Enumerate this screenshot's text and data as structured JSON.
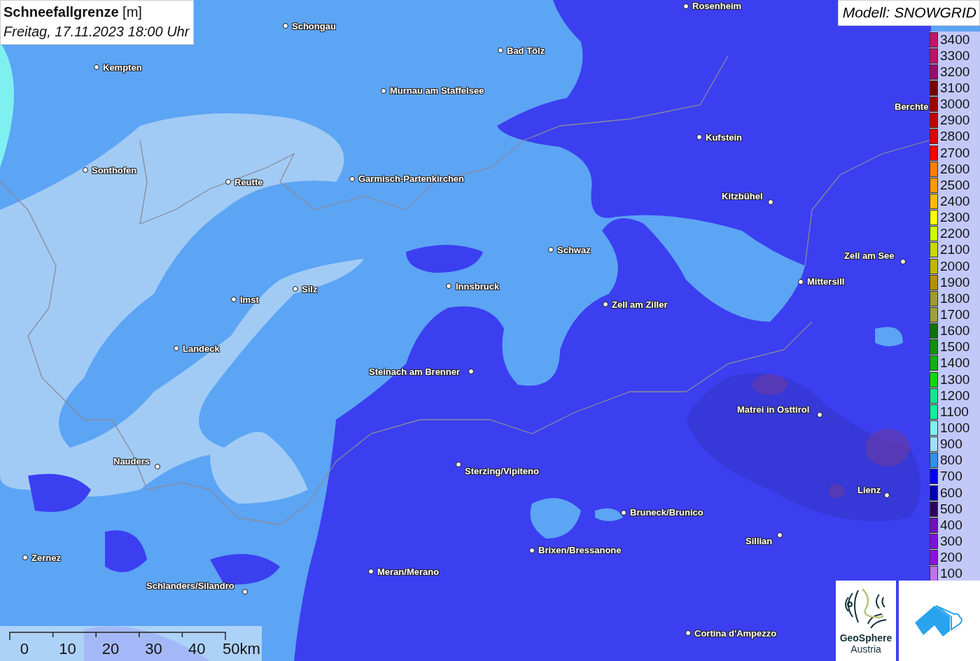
{
  "title": {
    "heading": "**Schneefallgrenze** [m]",
    "datetime": "Freitag, 17.11.2023 18:00 Uhr"
  },
  "model": "Modell: SNOWGRID",
  "cities": [
    {
      "name": "Rosenheim"
    },
    {
      "name": "Schongau"
    },
    {
      "name": "Kempten"
    },
    {
      "name": "Bad Tölz"
    },
    {
      "name": "Murnau am Staffelsee"
    },
    {
      "name": "Kufstein"
    },
    {
      "name": "Berchte"
    },
    {
      "name": "Sonthofen"
    },
    {
      "name": "Reutte"
    },
    {
      "name": "Garmisch-Partenkirchen"
    },
    {
      "name": "Kitzbühel"
    },
    {
      "name": "Schwaz"
    },
    {
      "name": "Zell am See"
    },
    {
      "name": "Silz"
    },
    {
      "name": "Innsbruck"
    },
    {
      "name": "Mittersill"
    },
    {
      "name": "Imst"
    },
    {
      "name": "Zell am Ziller"
    },
    {
      "name": "Landeck"
    },
    {
      "name": "Steinach am Brenner"
    },
    {
      "name": "Matrei in Osttirol"
    },
    {
      "name": "Nauders"
    },
    {
      "name": "Sterzing/Vipiteno"
    },
    {
      "name": "Lienz"
    },
    {
      "name": "Bruneck/Brunico"
    },
    {
      "name": "Sillian"
    },
    {
      "name": "Brixen/Bressanone"
    },
    {
      "name": "Zernez"
    },
    {
      "name": "Meran/Merano"
    },
    {
      "name": "Schlanders/Silandro"
    },
    {
      "name": "Cortina d'Ampezzo"
    }
  ],
  "legend": [
    {
      "label": "3400",
      "color": "#c8106e"
    },
    {
      "label": "3300",
      "color": "#c0106a"
    },
    {
      "label": "3200",
      "color": "#9a0a70"
    },
    {
      "label": "3100",
      "color": "#7a0000"
    },
    {
      "label": "3000",
      "color": "#a00000"
    },
    {
      "label": "2900",
      "color": "#c00000"
    },
    {
      "label": "2800",
      "color": "#e00000"
    },
    {
      "label": "2700",
      "color": "#ff0000"
    },
    {
      "label": "2600",
      "color": "#ff7f00"
    },
    {
      "label": "2500",
      "color": "#ff9900"
    },
    {
      "label": "2400",
      "color": "#ffbb00"
    },
    {
      "label": "2300",
      "color": "#ffff00"
    },
    {
      "label": "2200",
      "color": "#ccff00"
    },
    {
      "label": "2100",
      "color": "#c8d800"
    },
    {
      "label": "2000",
      "color": "#c0b800"
    },
    {
      "label": "1900",
      "color": "#b89000"
    },
    {
      "label": "1800",
      "color": "#a09a30"
    },
    {
      "label": "1700",
      "color": "#a0a040"
    },
    {
      "label": "1600",
      "color": "#107010"
    },
    {
      "label": "1500",
      "color": "#109010"
    },
    {
      "label": "1400",
      "color": "#10b010"
    },
    {
      "label": "1300",
      "color": "#10d810"
    },
    {
      "label": "1200",
      "color": "#10e890"
    },
    {
      "label": "1100",
      "color": "#10f0a0"
    },
    {
      "label": "1000",
      "color": "#80f0f0"
    },
    {
      "label": "900",
      "color": "#a0e0f8"
    },
    {
      "label": "800",
      "color": "#3090f0"
    },
    {
      "label": "700",
      "color": "#0000ff"
    },
    {
      "label": "600",
      "color": "#0000b0"
    },
    {
      "label": "500",
      "color": "#300060"
    },
    {
      "label": "400",
      "color": "#7010c0"
    },
    {
      "label": "300",
      "color": "#8010e0"
    },
    {
      "label": "200",
      "color": "#9010e0"
    },
    {
      "label": "100",
      "color": "#c070f0"
    }
  ],
  "scale": [
    "0",
    "10",
    "20",
    "30",
    "40",
    "50km"
  ],
  "logo": {
    "name": "GeoSphere",
    "country": "Austria"
  }
}
